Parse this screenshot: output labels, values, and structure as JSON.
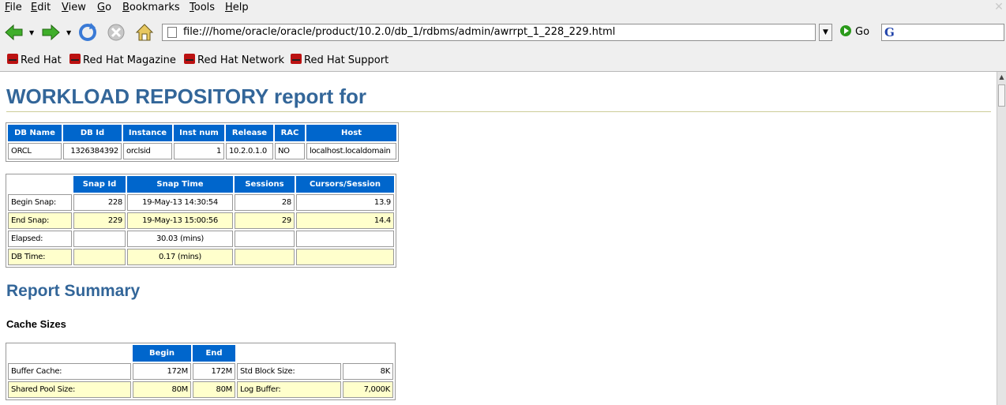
{
  "menu": {
    "items": [
      {
        "label": "File",
        "key": "F",
        "rest": "ile"
      },
      {
        "label": "Edit",
        "key": "E",
        "rest": "dit"
      },
      {
        "label": "View",
        "key": "V",
        "rest": "iew"
      },
      {
        "label": "Go",
        "key": "G",
        "rest": "o"
      },
      {
        "label": "Bookmarks",
        "key": "B",
        "rest": "ookmarks"
      },
      {
        "label": "Tools",
        "key": "T",
        "rest": "ools"
      },
      {
        "label": "Help",
        "key": "H",
        "rest": "elp"
      }
    ]
  },
  "navbar": {
    "url": "file:///home/oracle/oracle/product/10.2.0/db_1/rdbms/admin/awrrpt_1_228_229.html",
    "go_label": "Go",
    "search_engine_glyph": "G",
    "icons": [
      "back-arrow-icon",
      "forward-arrow-icon",
      "reload-icon",
      "stop-icon",
      "home-icon"
    ]
  },
  "bookmarks": [
    "Red Hat",
    "Red Hat Magazine",
    "Red Hat Network",
    "Red Hat Support"
  ],
  "report": {
    "title": "WORKLOAD REPOSITORY report for",
    "db_table": {
      "headers": [
        "DB Name",
        "DB Id",
        "Instance",
        "Inst num",
        "Release",
        "RAC",
        "Host"
      ],
      "row": [
        "ORCL",
        "1326384392",
        "orclsid",
        "1",
        "10.2.0.1.0",
        "NO",
        "localhost.localdomain"
      ]
    },
    "snap_table": {
      "headers": [
        "Snap Id",
        "Snap Time",
        "Sessions",
        "Cursors/Session"
      ],
      "rows": [
        [
          "Begin Snap:",
          "228",
          "19-May-13 14:30:54",
          "28",
          "13.9"
        ],
        [
          "End Snap:",
          "229",
          "19-May-13 15:00:56",
          "29",
          "14.4"
        ],
        [
          "Elapsed:",
          "",
          "30.03 (mins)",
          "",
          ""
        ],
        [
          "DB Time:",
          "",
          "0.17 (mins)",
          "",
          ""
        ]
      ]
    },
    "summary_heading": "Report Summary",
    "cache_heading": "Cache Sizes",
    "cache_table": {
      "headers": [
        "Begin",
        "End"
      ],
      "rows": [
        [
          "Buffer Cache:",
          "172M",
          "172M",
          "Std Block Size:",
          "8K"
        ],
        [
          "Shared Pool Size:",
          "80M",
          "80M",
          "Log Buffer:",
          "7,000K"
        ]
      ]
    }
  },
  "colors": {
    "header_blue": "#0066cc",
    "title_blue": "#336699",
    "alt_row": "#ffffcc",
    "bookmark_red": "#bb1111"
  }
}
